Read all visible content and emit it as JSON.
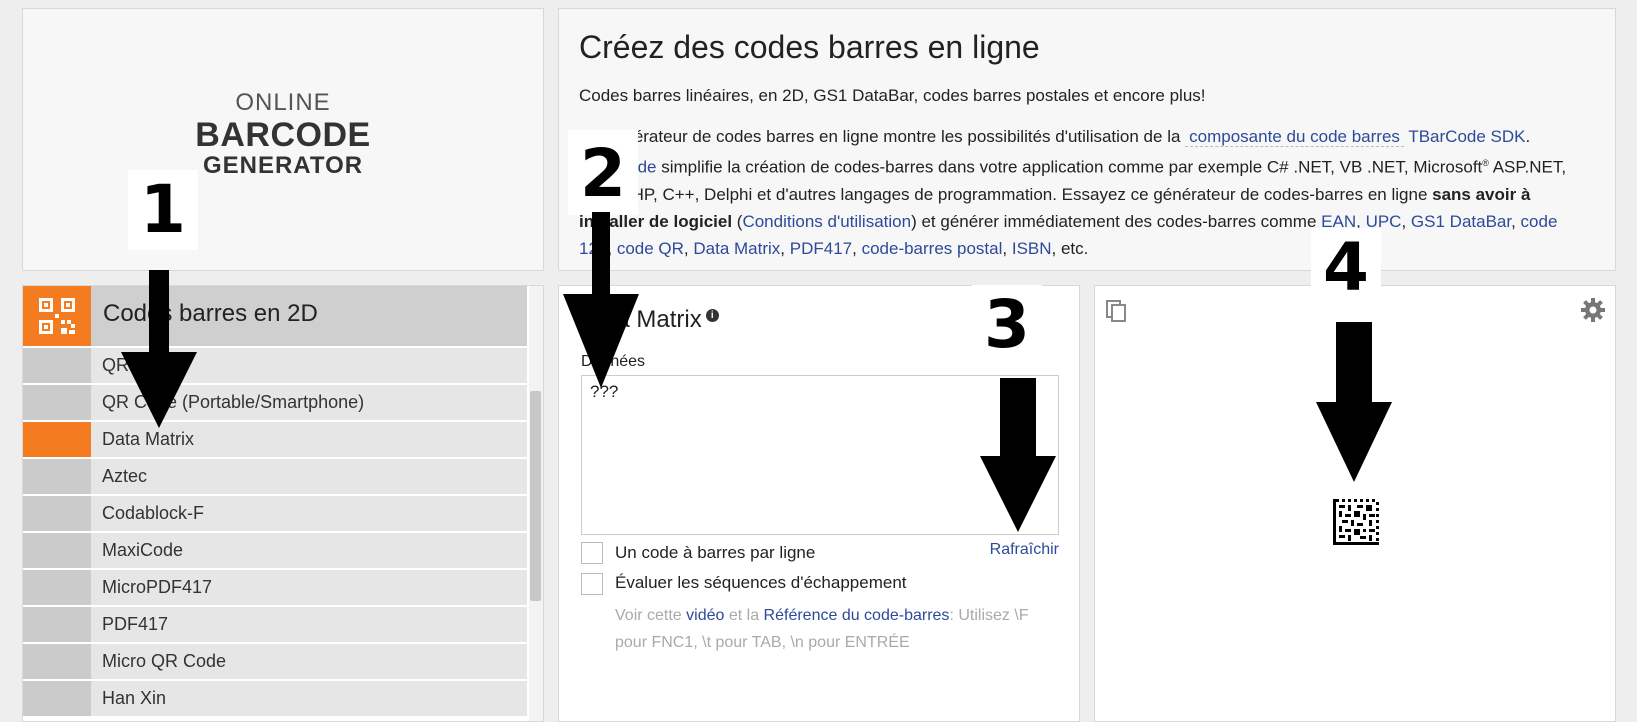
{
  "logo": {
    "line1": "ONLINE",
    "line2": "BARCODE",
    "line3": "GENERATOR"
  },
  "intro": {
    "title": "Créez des codes barres en ligne",
    "subtitle": "Codes barres linéaires, en 2D, GS1 DataBar, codes barres postales et encore plus!",
    "p2_a": "Ce générateur de codes barres en ligne montre les possibilités d'utilisation de la ",
    "link_component": "composante du code barres",
    "link_sdk": "TBarCode SDK",
    "p2_b": ". ",
    "link_tbarcode": "TBarCode",
    "p2_c": " simplifie la création de codes-barres dans votre application comme par exemple C# .NET, VB .NET, Microsoft",
    "reg": "®",
    "p2_d": " ASP.NET, ASP, PHP, C++, Delphi et d'autres langages de programmation. Essayez ce générateur de codes-barres en ligne ",
    "bold": "sans avoir à installer de logiciel",
    "p2_e": " (",
    "link_terms": "Conditions d'utilisation",
    "p2_f": ") et générer immédiatement des codes-barres comme ",
    "links": [
      "EAN",
      "UPC",
      "GS1 DataBar",
      "code 128",
      "code QR",
      "Data Matrix",
      "PDF417",
      "code-barres postal",
      "ISBN"
    ],
    "etc": ", etc."
  },
  "sidebar": {
    "category": "Codes barres en 2D",
    "items": [
      {
        "label": "QR Code"
      },
      {
        "label": "QR Code (Portable/Smartphone)"
      },
      {
        "label": "Data Matrix"
      },
      {
        "label": "Aztec"
      },
      {
        "label": "Codablock-F"
      },
      {
        "label": "MaxiCode"
      },
      {
        "label": "MicroPDF417"
      },
      {
        "label": "PDF417"
      },
      {
        "label": "Micro QR Code"
      },
      {
        "label": "Han Xin"
      }
    ],
    "selected": "Data Matrix"
  },
  "form": {
    "title": "Data Matrix",
    "data_label": "Données",
    "data_value": "???",
    "check1_label": "Un code à barres par ligne",
    "check2_label": "Évaluer les séquences d'échappement",
    "refresh_label": "Rafraîchir",
    "hint_a": "Voir cette ",
    "hint_link_video": "vidéo",
    "hint_b": " et la ",
    "hint_link_ref": "Référence du code-barres",
    "hint_c": ": Utilisez \\F pour FNC1, \\t pour TAB, \\n pour ENTRÉE"
  },
  "annotations": {
    "n1": "1",
    "n2": "2",
    "n3": "3",
    "n4": "4"
  },
  "colors": {
    "accent": "#f47b20",
    "link": "#2d4a9a"
  }
}
